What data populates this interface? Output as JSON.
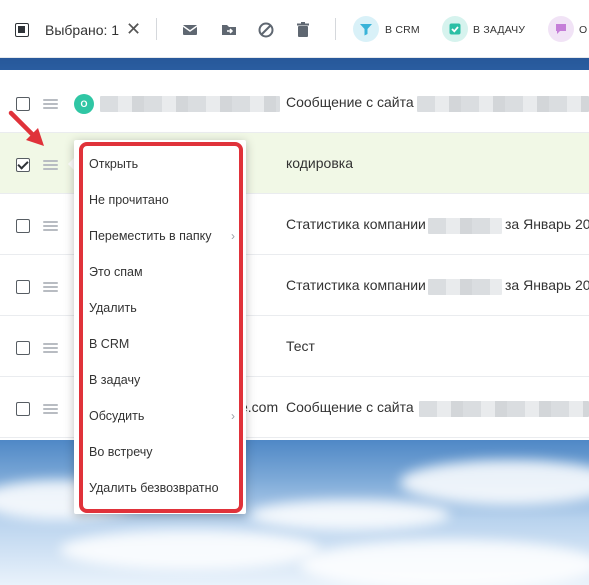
{
  "toolbar": {
    "selected_label": "Выбрано: 1",
    "close_glyph": "✕",
    "crm_label": "В CRM",
    "task_label": "В ЗАДАЧУ",
    "discuss_label": "О"
  },
  "rows": [
    {
      "avatar": "О",
      "sender_suffix": "",
      "subject": "Сообщение с сайта",
      "checked": false
    },
    {
      "avatar": "",
      "sender_suffix": "",
      "subject": "кодировка",
      "checked": true
    },
    {
      "avatar": "",
      "sender_suffix": "",
      "subject": "Статистика компании",
      "subject_tail": "за Январь 20",
      "checked": false
    },
    {
      "avatar": "",
      "sender_suffix": "",
      "subject": "Статистика компании",
      "subject_tail": "за Январь 20",
      "checked": false
    },
    {
      "avatar": "",
      "sender_suffix": "",
      "subject": "Тест",
      "checked": false
    },
    {
      "avatar": "",
      "sender_suffix": "e.com",
      "subject": "Сообщение с сайта",
      "checked": false
    }
  ],
  "context_menu": {
    "items": [
      {
        "label": "Открыть"
      },
      {
        "label": "Не прочитано"
      },
      {
        "label": "Переместить в папку"
      },
      {
        "label": "Это спам"
      },
      {
        "label": "Удалить"
      },
      {
        "label": "В CRM"
      },
      {
        "label": "В задачу"
      },
      {
        "label": "Обсудить"
      },
      {
        "label": "Во встречу"
      },
      {
        "label": "Удалить безвозвратно"
      }
    ],
    "submenu_arrow": "›"
  },
  "colors": {
    "highlight": "#e0323a",
    "selected_row": "#f1f8e6",
    "avatar": "#2fc6a4",
    "crm_pill": "#d9f1f8",
    "task_pill": "#d6f3ee",
    "discuss_pill": "#f1e3f6"
  },
  "icons": [
    "select-all-icon",
    "envelope-icon",
    "move-folder-icon",
    "block-icon",
    "trash-icon",
    "funnel-icon",
    "task-check-icon",
    "chat-icon",
    "drag-handle-icon",
    "red-arrow-icon"
  ]
}
